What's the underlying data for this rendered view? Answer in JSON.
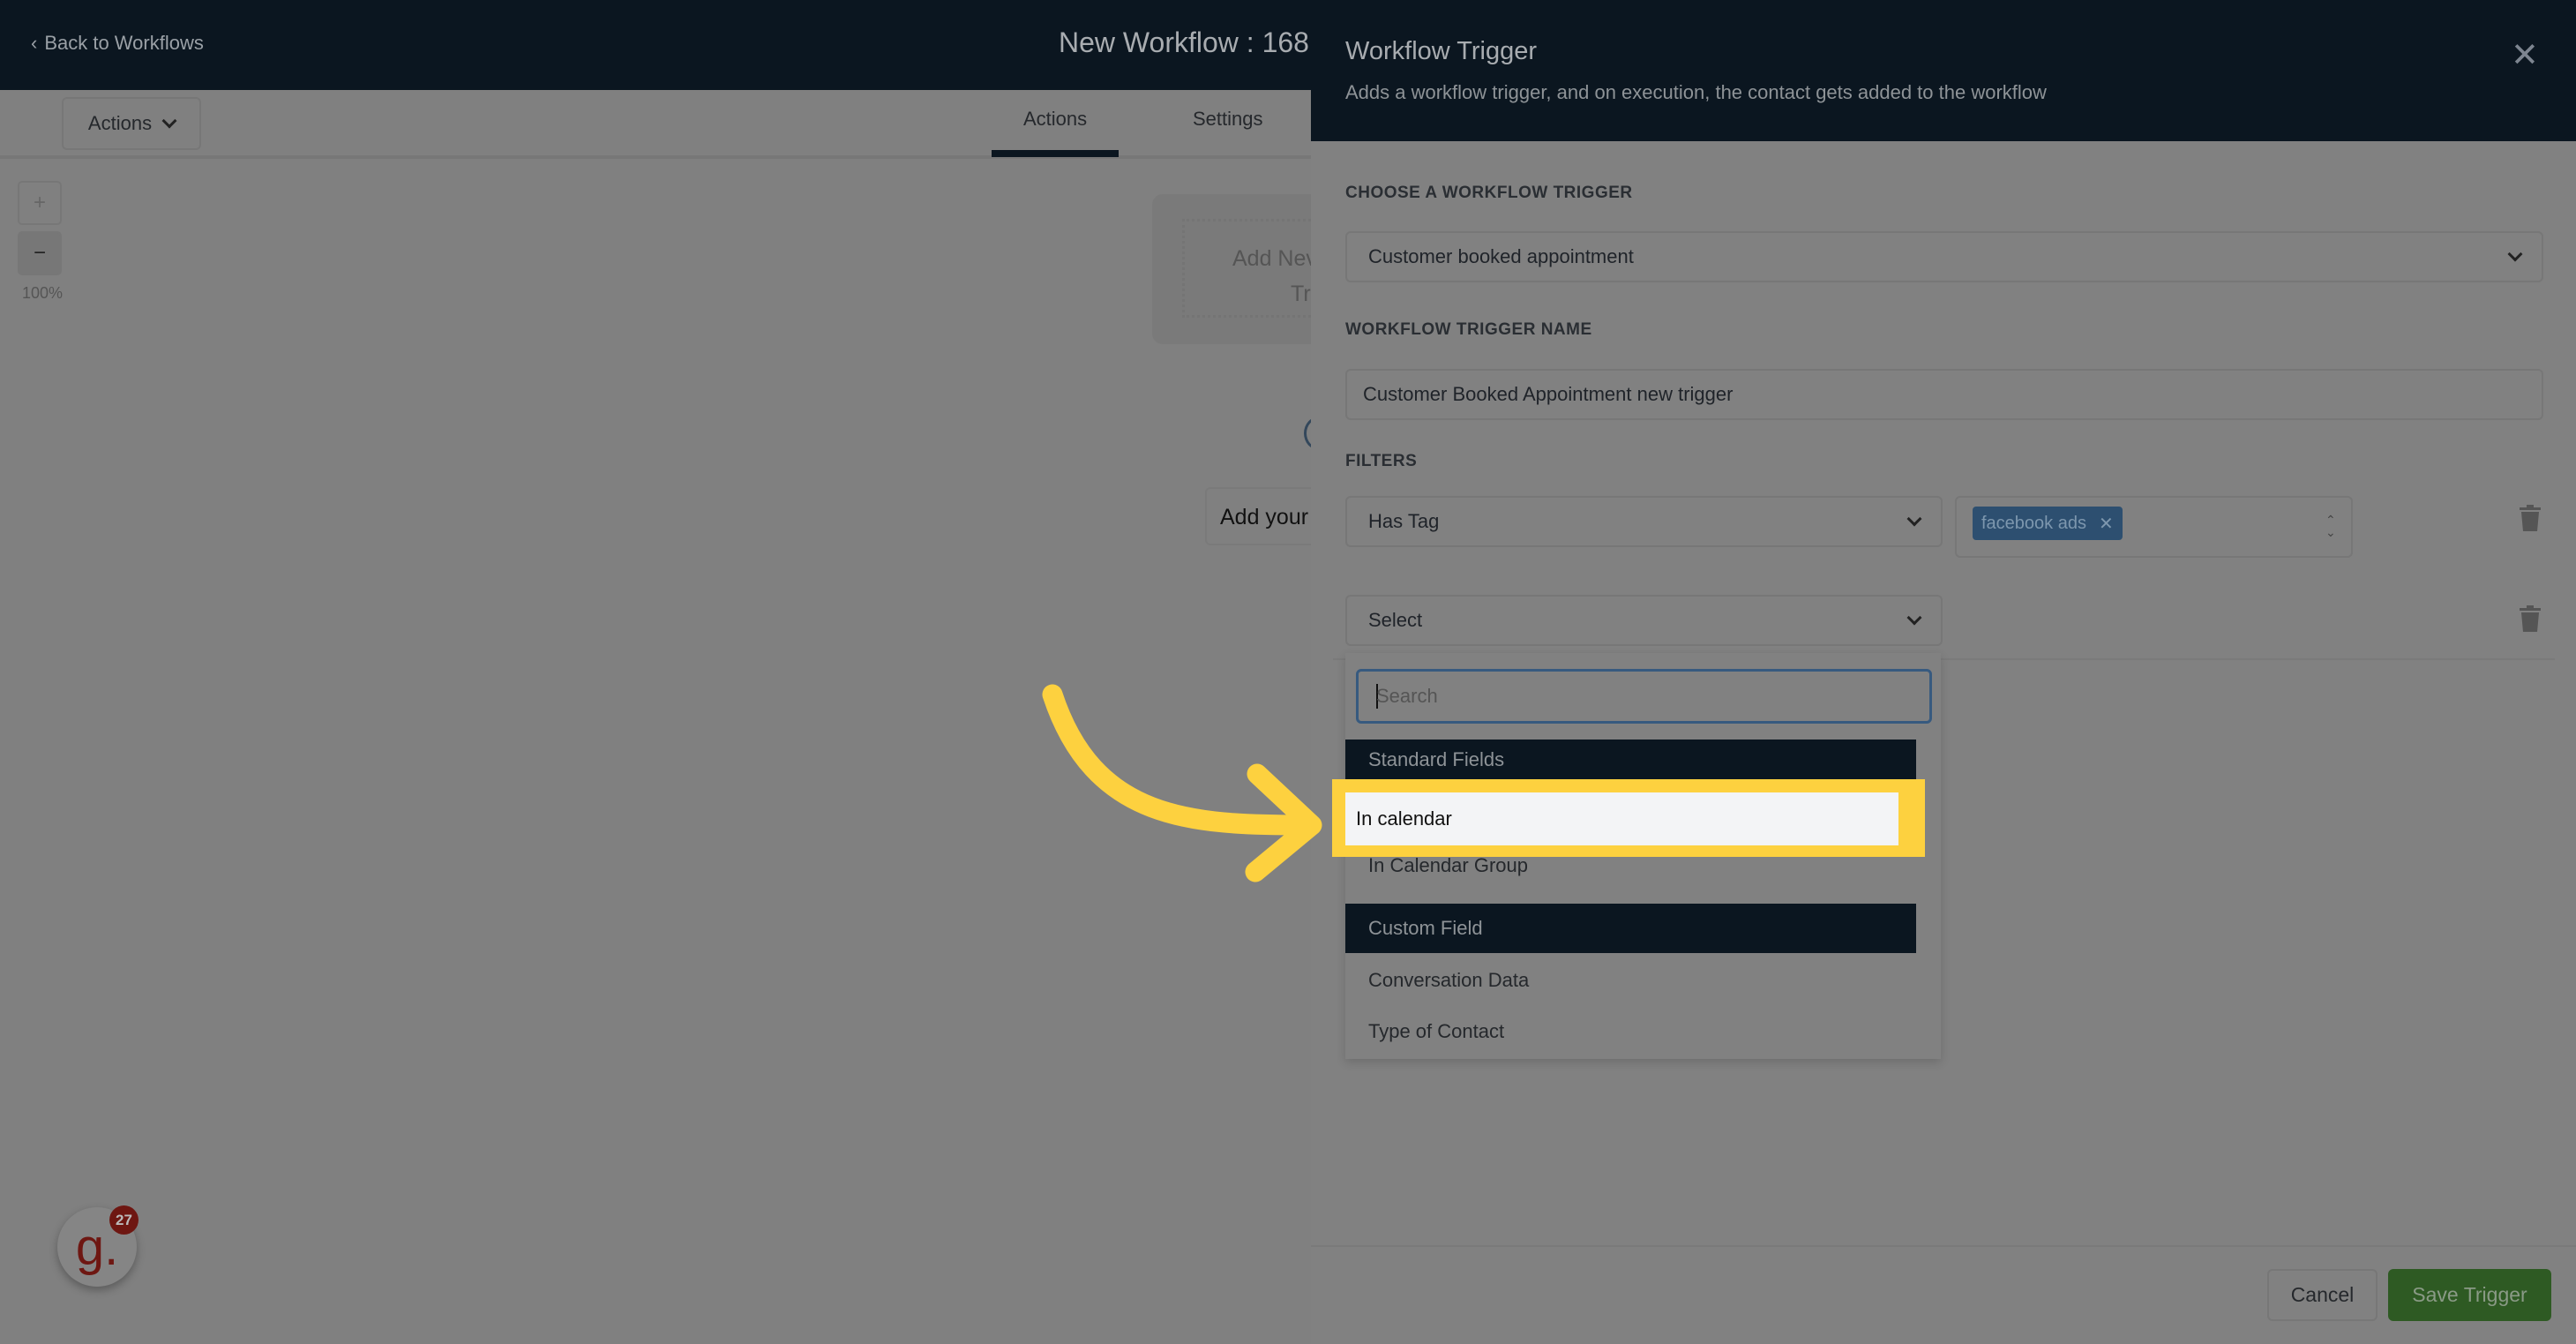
{
  "header": {
    "back_label": "Back to Workflows",
    "workflow_title": "New Workflow : 168"
  },
  "toolbar": {
    "actions_dropdown": "Actions",
    "tabs": [
      {
        "label": "Actions",
        "active": true
      },
      {
        "label": "Settings",
        "active": false
      }
    ]
  },
  "canvas": {
    "zoom_in": "+",
    "zoom_out": "−",
    "zoom_level": "100%",
    "trigger_card_line1": "Add Nev",
    "trigger_card_line2": "Tr",
    "add_your": "Add your"
  },
  "panel": {
    "title": "Workflow Trigger",
    "subtitle": "Adds a workflow trigger, and on execution, the contact gets added to the workflow",
    "close": "✕",
    "choose_label": "CHOOSE A WORKFLOW TRIGGER",
    "trigger_value": "Customer booked appointment",
    "name_label": "WORKFLOW TRIGGER NAME",
    "name_value": "Customer Booked Appointment new trigger",
    "filters_label": "FILTERS",
    "filters": [
      {
        "field": "Has Tag",
        "tags": [
          "facebook ads"
        ]
      },
      {
        "field": "Select"
      }
    ],
    "dropdown": {
      "search_placeholder": "Search",
      "groups": [
        {
          "label": "Standard Fields",
          "options": [
            "In calendar",
            "In Calendar Group"
          ]
        },
        {
          "label": "Custom Field",
          "options": [
            "Conversation Data",
            "Type of Contact"
          ]
        }
      ],
      "highlighted": "In calendar"
    },
    "cancel": "Cancel",
    "save": "Save Trigger"
  },
  "widget": {
    "letter": "g.",
    "badge": "27"
  },
  "colors": {
    "header": "#0b1620",
    "highlight": "#fdd13f",
    "save": "#2e5a23",
    "tag": "#2d4f70"
  }
}
